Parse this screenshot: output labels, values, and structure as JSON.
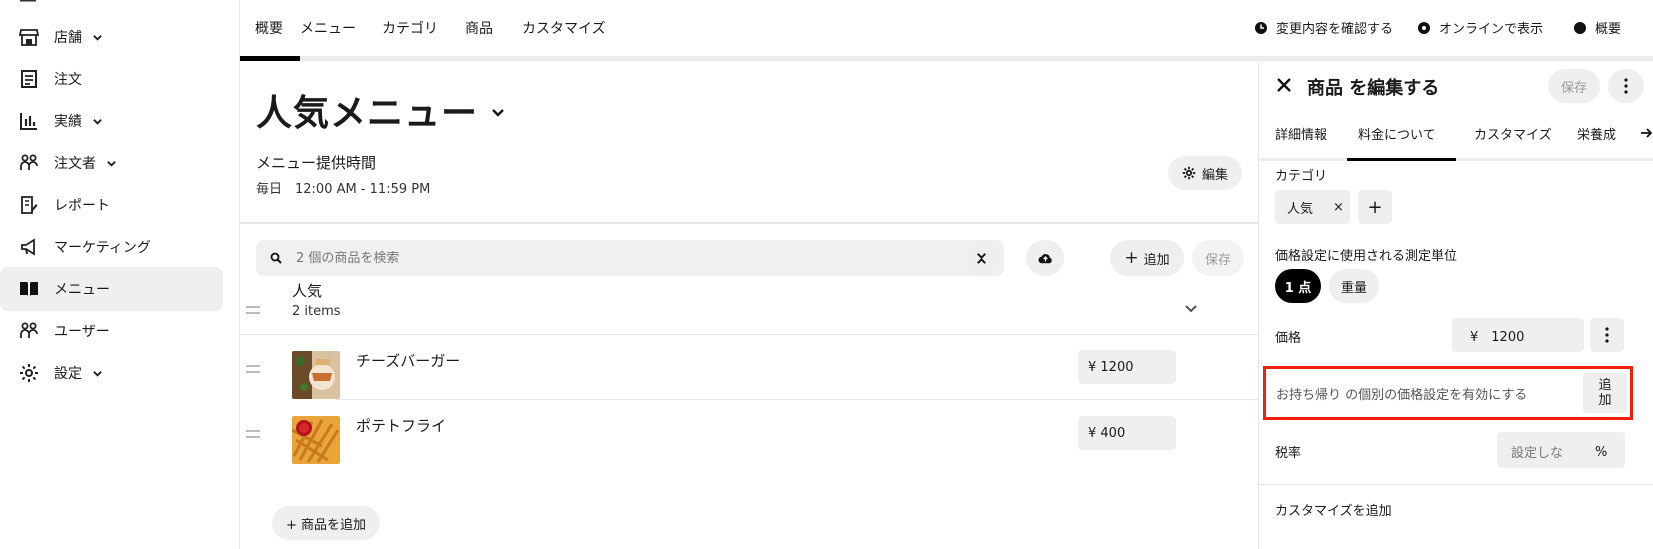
{
  "sidebar": {
    "items": [
      {
        "label": "店舗",
        "icon": "store-icon",
        "has_chevron": true
      },
      {
        "label": "注文",
        "icon": "receipt-icon",
        "has_chevron": false
      },
      {
        "label": "実績",
        "icon": "bar-chart-icon",
        "has_chevron": true
      },
      {
        "label": "注文者",
        "icon": "people-icon",
        "has_chevron": true
      },
      {
        "label": "レポート",
        "icon": "report-icon",
        "has_chevron": false
      },
      {
        "label": "マーケティング",
        "icon": "megaphone-icon",
        "has_chevron": false
      },
      {
        "label": "メニュー",
        "icon": "book-icon",
        "has_chevron": false,
        "active": true
      },
      {
        "label": "ユーザー",
        "icon": "users-icon",
        "has_chevron": false
      },
      {
        "label": "設定",
        "icon": "gear-icon",
        "has_chevron": true
      }
    ]
  },
  "topnav": {
    "tabs": [
      {
        "label": "概要",
        "active": true
      },
      {
        "label": "メニュー"
      },
      {
        "label": "カテゴリ"
      },
      {
        "label": "商品"
      },
      {
        "label": "カスタマイズ"
      }
    ],
    "actions": {
      "review_changes": "変更内容を確認する",
      "view_online": "オンラインで表示",
      "overview": "概要"
    }
  },
  "main": {
    "title": "人気メニュー",
    "hours_label": "メニュー提供時間",
    "hours_value": "毎日　12:00 AM - 11:59 PM",
    "edit_label": "編集",
    "search_placeholder": "2 個の商品を検索",
    "add_label": "追加",
    "save_label": "保存",
    "category": {
      "name": "人気",
      "count": "2 items",
      "items": [
        {
          "name": "チーズバーガー",
          "price": "¥ 1200",
          "thumb": "cheeseburger-photo"
        },
        {
          "name": "ポテトフライ",
          "price": "¥ 400",
          "thumb": "fries-photo"
        }
      ]
    },
    "add_item_label": "+ 商品を追加"
  },
  "panel": {
    "title": "商品 を編集する",
    "save_label": "保存",
    "tabs": [
      {
        "label": "詳細情報"
      },
      {
        "label": "料金について",
        "active": true
      },
      {
        "label": "カスタマイズ"
      },
      {
        "label": "栄養成"
      }
    ],
    "category_label": "カテゴリ",
    "category_chip": "人気",
    "chip_remove": "×",
    "chip_add": "+",
    "unit_label": "価格設定に使用される測定単位",
    "unit_options": [
      "1 点",
      "重量"
    ],
    "price_label": "価格",
    "price_value": "¥　1200",
    "takeout_text": "お持ち帰り の個別の価格設定を有効にする",
    "takeout_btn_line1": "追",
    "takeout_btn_line2": "加",
    "tax_label": "税率",
    "tax_placeholder": "設定しな",
    "tax_unit": "%",
    "customize_label": "カスタマイズを追加"
  },
  "colors": {
    "highlight_border": "#f0200a",
    "active_tab": "#000000",
    "chip_bg": "#efefef"
  }
}
